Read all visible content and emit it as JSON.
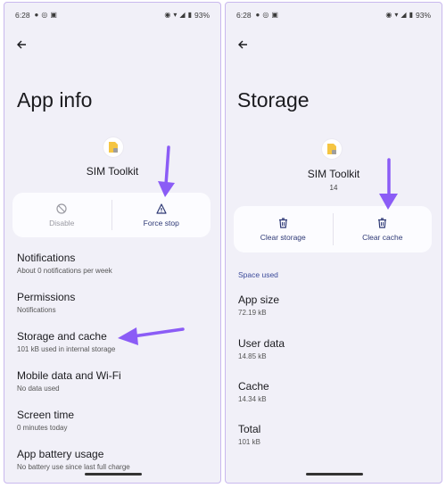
{
  "left": {
    "status": {
      "time": "6:28",
      "battery": "93%"
    },
    "title": "App info",
    "app_name": "SIM Toolkit",
    "actions": [
      {
        "label": "Disable",
        "icon": "disable-icon",
        "enabled": false
      },
      {
        "label": "Force stop",
        "icon": "warning-icon",
        "enabled": true
      }
    ],
    "items": [
      {
        "title": "Notifications",
        "sub": "About 0 notifications per week"
      },
      {
        "title": "Permissions",
        "sub": "Notifications"
      },
      {
        "title": "Storage and cache",
        "sub": "101 kB used in internal storage"
      },
      {
        "title": "Mobile data and Wi-Fi",
        "sub": "No data used"
      },
      {
        "title": "Screen time",
        "sub": "0 minutes today"
      },
      {
        "title": "App battery usage",
        "sub": "No battery use since last full charge"
      }
    ]
  },
  "right": {
    "status": {
      "time": "6:28",
      "battery": "93%"
    },
    "title": "Storage",
    "app_name": "SIM Toolkit",
    "version": "14",
    "actions": [
      {
        "label": "Clear storage",
        "icon": "trash-icon"
      },
      {
        "label": "Clear cache",
        "icon": "trash-icon"
      }
    ],
    "section": "Space used",
    "items": [
      {
        "title": "App size",
        "sub": "72.19 kB"
      },
      {
        "title": "User data",
        "sub": "14.85 kB"
      },
      {
        "title": "Cache",
        "sub": "14.34 kB"
      },
      {
        "title": "Total",
        "sub": "101 kB"
      }
    ]
  },
  "colors": {
    "annotation_arrow": "#8b5cf6",
    "accent_text": "#2f3a76",
    "background": "#f1f0f8"
  }
}
